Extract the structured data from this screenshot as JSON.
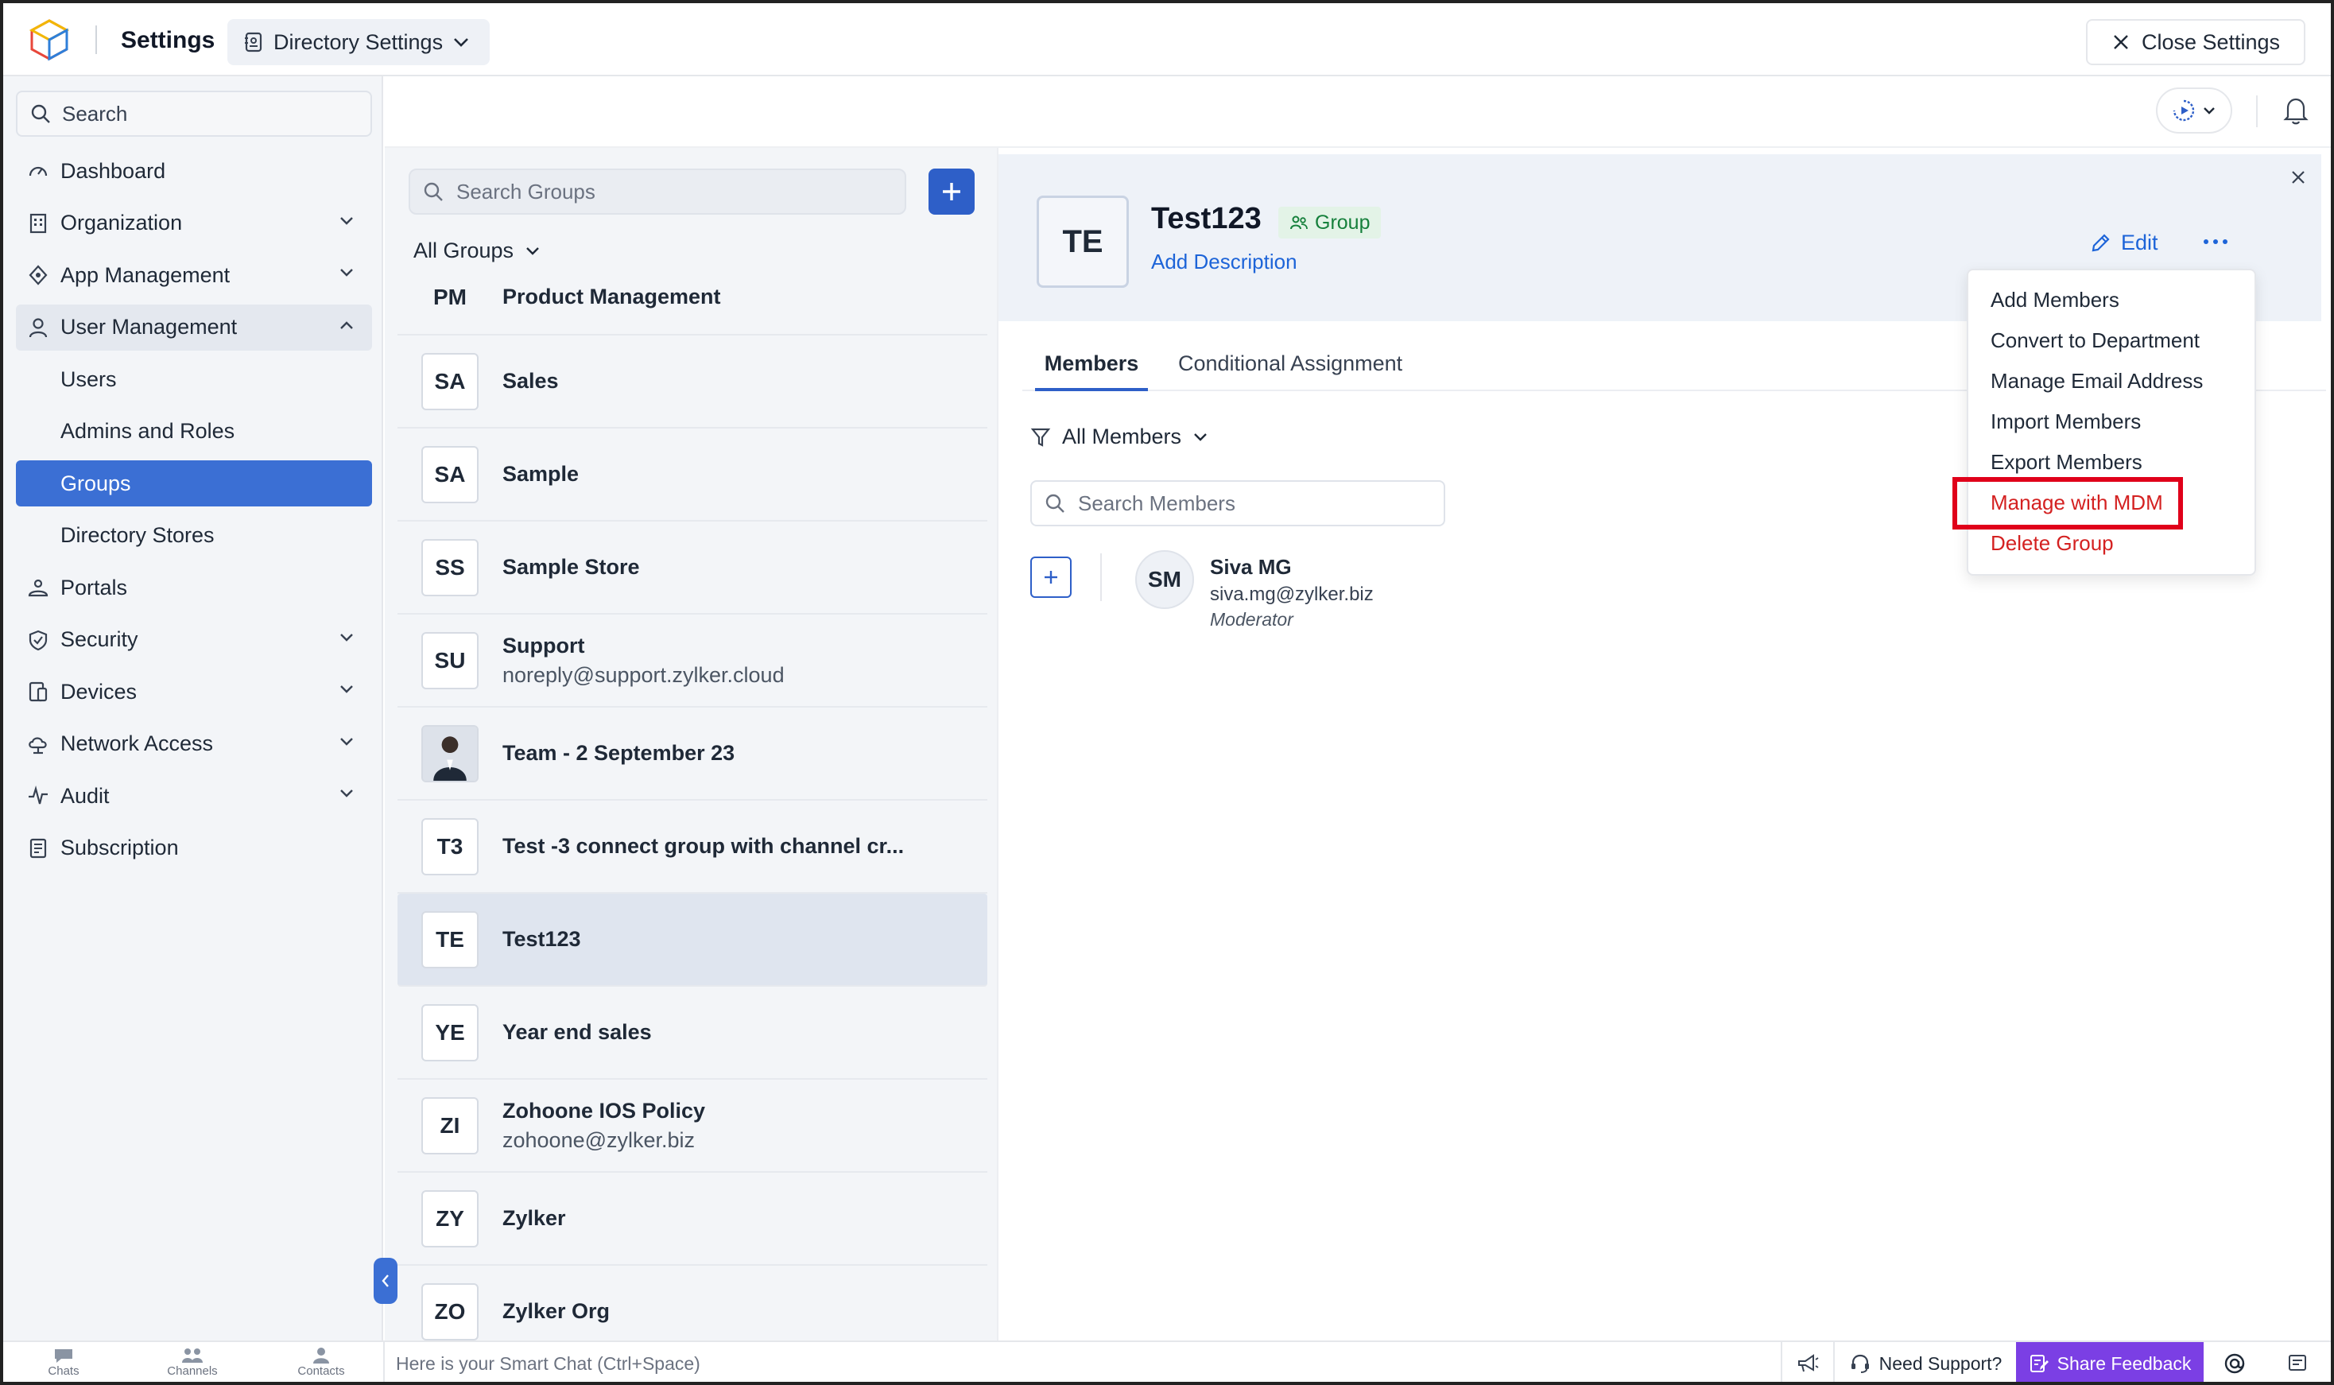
{
  "header": {
    "app_title": "Settings",
    "context_select": "Directory Settings",
    "close_label": "Close Settings"
  },
  "sidebar": {
    "search_placeholder": "Search",
    "items": [
      {
        "label": "Dashboard",
        "icon": "dashboard-icon"
      },
      {
        "label": "Organization",
        "icon": "organization-icon",
        "expandable": true
      },
      {
        "label": "App Management",
        "icon": "app-management-icon",
        "expandable": true
      },
      {
        "label": "User Management",
        "icon": "user-icon",
        "expandable": true,
        "expanded": true
      },
      {
        "label": "Users",
        "sub": true
      },
      {
        "label": "Admins and Roles",
        "sub": true
      },
      {
        "label": "Groups",
        "sub": true,
        "active": true
      },
      {
        "label": "Directory Stores",
        "sub": true
      },
      {
        "label": "Portals",
        "icon": "portals-icon"
      },
      {
        "label": "Security",
        "icon": "shield-icon",
        "expandable": true
      },
      {
        "label": "Devices",
        "icon": "devices-icon",
        "expandable": true
      },
      {
        "label": "Network Access",
        "icon": "cloud-icon",
        "expandable": true
      },
      {
        "label": "Audit",
        "icon": "audit-icon",
        "expandable": true
      },
      {
        "label": "Subscription",
        "icon": "subscription-icon"
      }
    ]
  },
  "groups": {
    "search_placeholder": "Search Groups",
    "filter_label": "All Groups",
    "items": [
      {
        "initials": "PM",
        "name": "Product Management",
        "sub": ""
      },
      {
        "initials": "SA",
        "name": "Sales",
        "sub": ""
      },
      {
        "initials": "SA",
        "name": "Sample",
        "sub": ""
      },
      {
        "initials": "SS",
        "name": "Sample Store",
        "sub": ""
      },
      {
        "initials": "SU",
        "name": "Support",
        "sub": "noreply@support.zylker.cloud"
      },
      {
        "initials": "",
        "name": "Team - 2 September 23",
        "sub": "",
        "photo": true
      },
      {
        "initials": "T3",
        "name": "Test -3 connect group with channel cr...",
        "sub": ""
      },
      {
        "initials": "TE",
        "name": "Test123",
        "sub": "",
        "selected": true
      },
      {
        "initials": "YE",
        "name": "Year end sales",
        "sub": ""
      },
      {
        "initials": "ZI",
        "name": "Zohoone IOS Policy",
        "sub": "zohoone@zylker.biz"
      },
      {
        "initials": "ZY",
        "name": "Zylker",
        "sub": ""
      },
      {
        "initials": "ZO",
        "name": "Zylker Org",
        "sub": ""
      }
    ]
  },
  "detail": {
    "initials": "TE",
    "title": "Test123",
    "badge": "Group",
    "add_description": "Add Description",
    "edit_label": "Edit",
    "tabs": [
      "Members",
      "Conditional Assignment"
    ],
    "members_filter": "All Members",
    "members_search_placeholder": "Search Members",
    "member": {
      "initials": "SM",
      "name": "Siva MG",
      "email": "siva.mg@zylker.biz",
      "role": "Moderator"
    }
  },
  "menu": {
    "items": [
      {
        "label": "Add Members",
        "danger": false
      },
      {
        "label": "Convert to Department",
        "danger": false
      },
      {
        "label": "Manage Email Address",
        "danger": false
      },
      {
        "label": "Import Members",
        "danger": false
      },
      {
        "label": "Export Members",
        "danger": false
      },
      {
        "label": "Manage with MDM",
        "danger": true,
        "highlighted": true
      },
      {
        "label": "Delete Group",
        "danger": true
      }
    ]
  },
  "bottombar": {
    "chats": "Chats",
    "channels": "Channels",
    "contacts": "Contacts",
    "smart_chat_placeholder": "Here is your Smart Chat (Ctrl+Space)",
    "need_support": "Need Support?",
    "share_feedback": "Share Feedback"
  },
  "colors": {
    "primary": "#2e5fc8",
    "active_nav": "#3b6fd4",
    "danger": "#d42121",
    "highlight_box": "#e0001a",
    "feedback": "#7b3fe4",
    "badge_green": "#16803c"
  }
}
